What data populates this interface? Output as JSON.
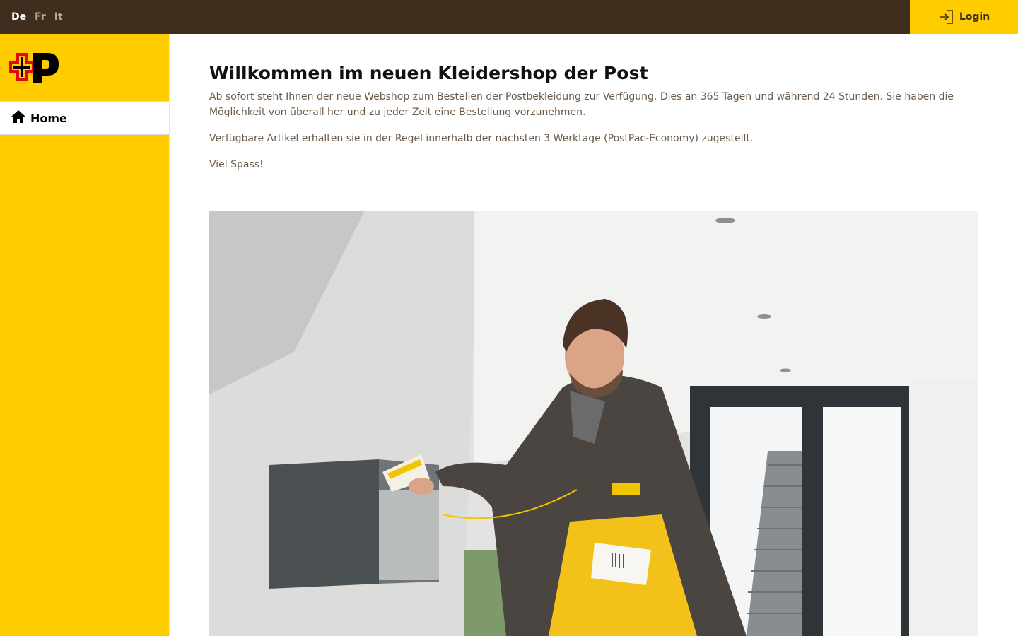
{
  "languages": [
    {
      "label": "De",
      "active": true
    },
    {
      "label": "Fr",
      "active": false
    },
    {
      "label": "It",
      "active": false
    }
  ],
  "header": {
    "login_label": "Login",
    "login_icon": "login-icon"
  },
  "sidebar": {
    "logo": "swiss-post-logo",
    "items": [
      {
        "label": "Home",
        "icon": "home-icon"
      }
    ]
  },
  "main": {
    "title": "Willkommen im neuen Kleidershop der Post",
    "paragraphs": [
      "Ab sofort steht Ihnen der neue Webshop zum Bestellen der Postbekleidung zur Verfügung. Dies an 365 Tagen und während 24 Stunden. Sie haben die Möglichkeit von überall her und zu jeder Zeit eine Bestellung vorzunehmen.",
      "Verfügbare Artikel erhalten sie in der Regel innerhalb der nächsten 3 Werktage (PostPac-Economy) zugestellt.",
      "Viel Spass!"
    ],
    "hero_image": "Postbote wirft Brief in Briefkasten"
  },
  "colors": {
    "topbar": "#3f2e1e",
    "accent_yellow": "#ffcc00",
    "post_red": "#e30613",
    "body_text": "#6b5a4a"
  }
}
